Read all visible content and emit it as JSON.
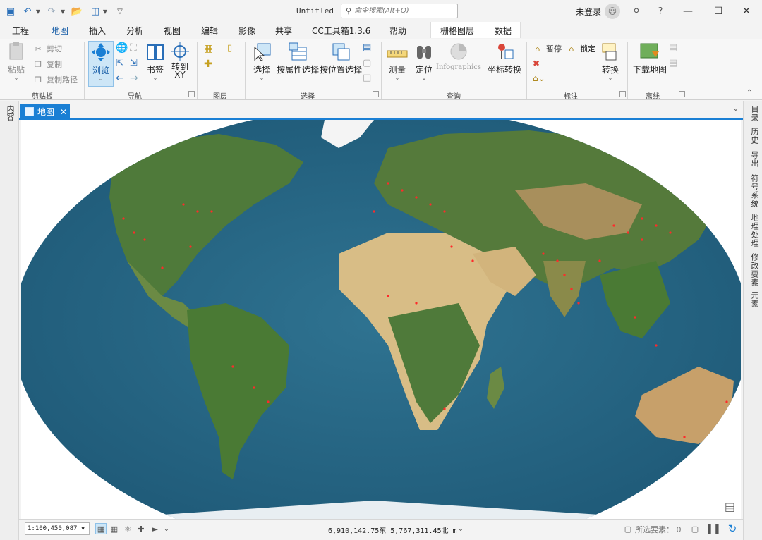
{
  "app": {
    "title": "Untitled",
    "search_placeholder": "命令搜索(Alt+Q)",
    "user_label": "未登录",
    "help_label": "?"
  },
  "ribbon": {
    "tabs": [
      "工程",
      "地图",
      "插入",
      "分析",
      "视图",
      "编辑",
      "影像",
      "共享",
      "CC工具箱1.3.6",
      "帮助",
      "栅格图层",
      "数据"
    ],
    "active_tab": "地图",
    "clipboard": {
      "paste": "粘贴",
      "cut": "剪切",
      "copy": "复制",
      "copy_path": "复制路径",
      "label": "剪贴板"
    },
    "navigate": {
      "explore": "浏览",
      "bookmarks": "书签",
      "goto_xy": "转到\nXY",
      "label": "导航"
    },
    "layer": {
      "label": "图层"
    },
    "selection": {
      "select": "选择",
      "by_attr": "按属性选择",
      "by_loc": "按位置选择",
      "label": "选择"
    },
    "inquiry": {
      "measure": "测量",
      "locate": "定位",
      "infographics": "Infographics",
      "convert_coords": "坐标转换",
      "label": "查询"
    },
    "labeling": {
      "pause": "暂停",
      "lock": "锁定",
      "convert": "转换",
      "label": "标注"
    },
    "offline": {
      "download": "下载地图",
      "label": "离线"
    }
  },
  "panels": {
    "left": [
      "内容"
    ],
    "right": [
      "目录",
      "历史",
      "导出",
      "符号系统",
      "地理处理",
      "修改要素",
      "元素"
    ]
  },
  "map_view": {
    "tab_label": "地图",
    "scale": "1:100,450,087",
    "coordinates": "6,910,142.75东 5,767,311.45北 m",
    "selected_features_label": "所选要素：",
    "selected_features_count": "0"
  },
  "colors": {
    "accent": "#1a7fd4",
    "ocean": "#2d6e8e",
    "land_green": "#4f7a3a",
    "desert": "#d8bd86",
    "points": "#ff2a2a"
  }
}
